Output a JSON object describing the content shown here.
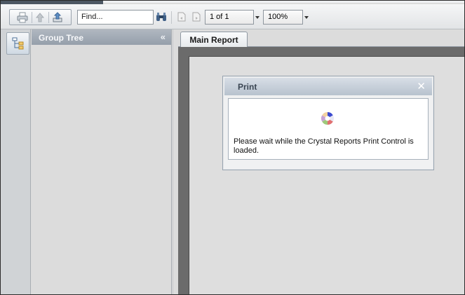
{
  "toolbar": {
    "find_placeholder": "Find...",
    "page_indicator": "1 of 1",
    "zoom_level": "100%",
    "icons": {
      "print": "printer-icon",
      "upload": "up-arrow-icon",
      "export": "export-icon",
      "search": "binoculars-icon",
      "prev_page": "previous-page-icon",
      "next_page": "next-page-icon"
    }
  },
  "rail": {
    "icon": "group-tree-icon"
  },
  "panel": {
    "title": "Group Tree",
    "collapse_symbol": "«"
  },
  "tabs": [
    {
      "label": "Main Report"
    }
  ],
  "dialog": {
    "title": "Print",
    "close_symbol": "✕",
    "message": "Please wait while the Crystal Reports Print Control is loaded."
  },
  "colors": {
    "panel_header": "#a3abb5",
    "dialog_header": "#c8d0da",
    "report_border": "#6b6b6b",
    "background": "#dcdcdc"
  }
}
